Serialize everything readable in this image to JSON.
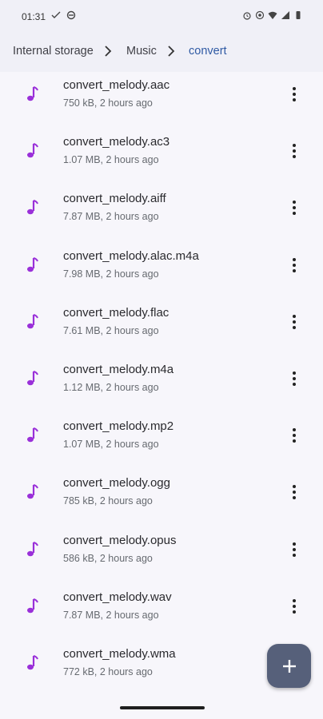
{
  "status_bar": {
    "time": "01:31",
    "left_icons": [
      "check-mark-icon",
      "no-symbol-icon"
    ],
    "right_icons": [
      "alarm-icon",
      "location-icon",
      "wifi-icon",
      "signal-icon",
      "battery-icon"
    ]
  },
  "breadcrumb": {
    "items": [
      "Internal storage",
      "Music",
      "convert"
    ]
  },
  "files": [
    {
      "name": "convert_melody.aac",
      "meta": "750 kB, 2 hours ago"
    },
    {
      "name": "convert_melody.ac3",
      "meta": "1.07 MB, 2 hours ago"
    },
    {
      "name": "convert_melody.aiff",
      "meta": "7.87 MB, 2 hours ago"
    },
    {
      "name": "convert_melody.alac.m4a",
      "meta": "7.98 MB, 2 hours ago"
    },
    {
      "name": "convert_melody.flac",
      "meta": "7.61 MB, 2 hours ago"
    },
    {
      "name": "convert_melody.m4a",
      "meta": "1.12 MB, 2 hours ago"
    },
    {
      "name": "convert_melody.mp2",
      "meta": "1.07 MB, 2 hours ago"
    },
    {
      "name": "convert_melody.ogg",
      "meta": "785 kB, 2 hours ago"
    },
    {
      "name": "convert_melody.opus",
      "meta": "586 kB, 2 hours ago"
    },
    {
      "name": "convert_melody.wav",
      "meta": "7.87 MB, 2 hours ago"
    },
    {
      "name": "convert_melody.wma",
      "meta": "772 kB, 2 hours ago"
    }
  ],
  "colors": {
    "accent_music": "#9a30d9",
    "breadcrumb_active": "#2f5aa4",
    "fab": "#56607a"
  }
}
